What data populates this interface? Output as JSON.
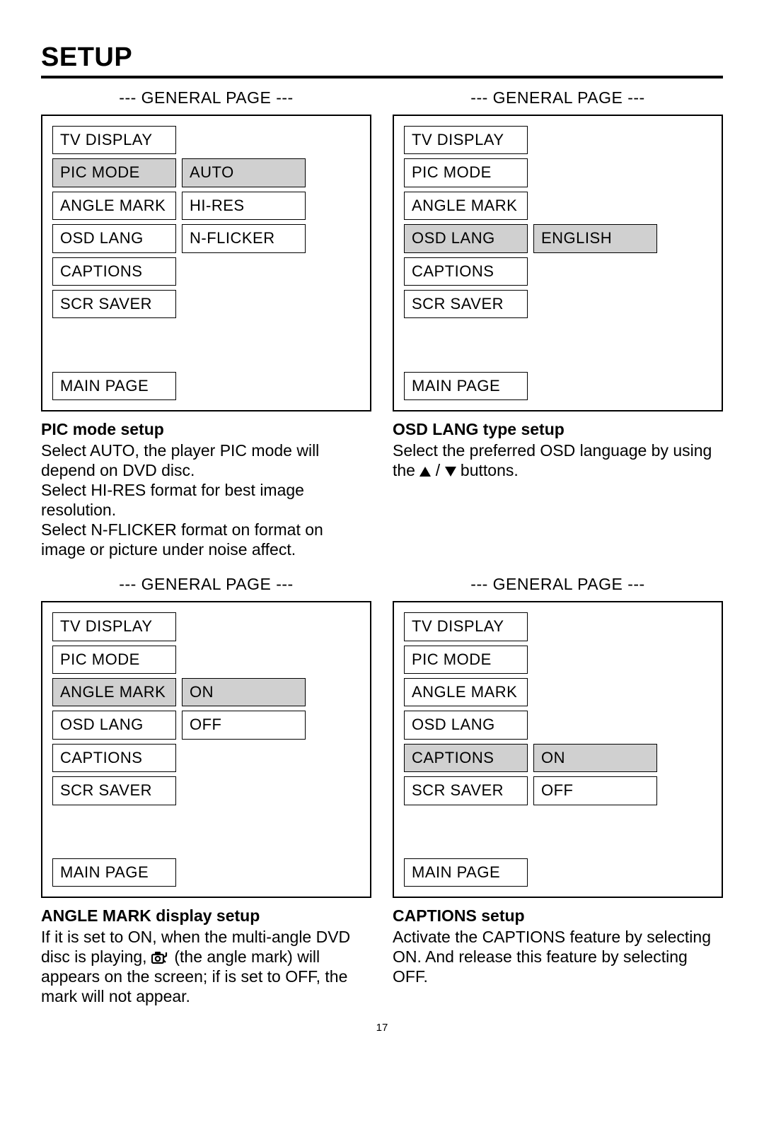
{
  "page": {
    "title": "SETUP",
    "number": "17"
  },
  "common": {
    "panelHeader": "--- GENERAL PAGE ---",
    "menuItems": [
      "TV DISPLAY",
      "PIC MODE",
      "ANGLE MARK",
      "OSD LANG",
      "CAPTIONS",
      "SCR SAVER"
    ],
    "mainPage": "MAIN PAGE"
  },
  "panels": {
    "picMode": {
      "options": [
        "AUTO",
        "HI-RES",
        "N-FLICKER"
      ],
      "title": "PIC mode setup",
      "body1": "Select AUTO, the player PIC mode will depend on DVD disc.",
      "body2": "Select HI-RES format for best image resolution.",
      "body3": "Select N-FLICKER format on format on image or picture under noise affect."
    },
    "osdLang": {
      "option": "ENGLISH",
      "title": "OSD LANG type setup",
      "body_a": "Select the preferred OSD language by using the ",
      "body_b": " / ",
      "body_c": " buttons."
    },
    "angleMark": {
      "options": [
        "ON",
        "OFF"
      ],
      "title": "ANGLE MARK display setup",
      "body_a": "If it is set to ON, when the multi-angle DVD disc is playing, ",
      "body_b": " (the angle mark) will appears on the screen; if is set to OFF, the mark will not appear."
    },
    "captions": {
      "options": [
        "ON",
        "OFF"
      ],
      "title": "CAPTIONS setup",
      "body": "Activate the CAPTIONS feature by selecting ON.  And release this feature by selecting OFF."
    }
  }
}
